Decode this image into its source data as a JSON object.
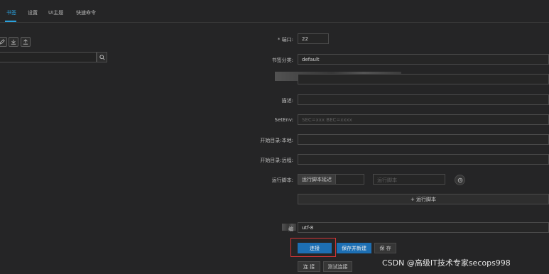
{
  "tabs": [
    "书签",
    "设置",
    "UI主题",
    "快速命令"
  ],
  "search": {
    "placeholder": ""
  },
  "form": {
    "port_label": "* 端口:",
    "port_value": "22",
    "category_label": "书签分类:",
    "category_value": "default",
    "description_label": "描述:",
    "setenv_label": "SetEnv:",
    "setenv_placeholder": "SEC=xxx BEC=xxxx",
    "start_local_label": "开始目录:本地:",
    "start_remote_label": "开始目录:远程:",
    "run_script_label": "运行脚本:",
    "run_script_after_button": "运行脚本延迟",
    "run_script_placeholder": "运行脚本",
    "add_run_script": "+ 运行脚本",
    "encoding_label": "编",
    "encoding_value": "utf-8"
  },
  "actions": {
    "save_connect": "连接",
    "save_new": "保存并新建",
    "save": "保 存",
    "connect": "连 接",
    "test_connect": "测试连接"
  },
  "watermark": "CSDN @高级IT技术专家secops998"
}
